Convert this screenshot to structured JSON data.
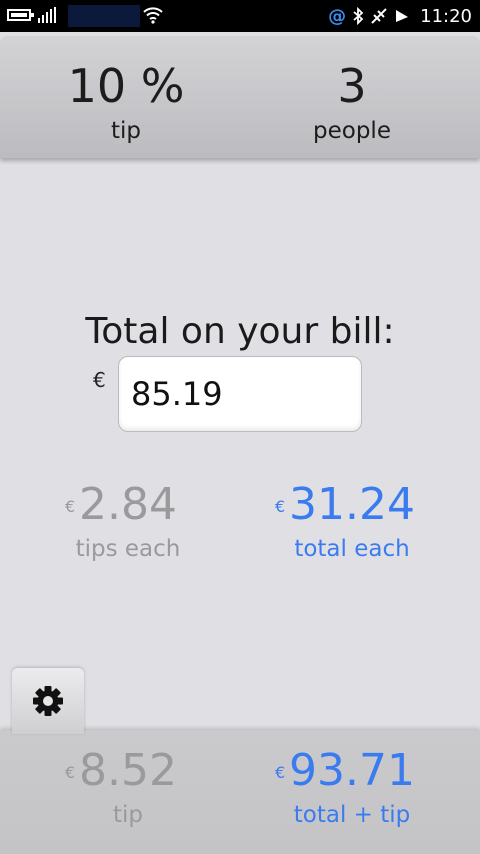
{
  "status_bar": {
    "time": "11:20",
    "icons": [
      "battery-icon",
      "signal-icon",
      "wifi-icon",
      "at-icon",
      "bluetooth-icon",
      "no-signal-icon",
      "alarm-icon"
    ]
  },
  "settings": {
    "tip": {
      "value": "10 %",
      "label": "tip"
    },
    "people": {
      "value": "3",
      "label": "people"
    }
  },
  "bill": {
    "label": "Total on your bill:",
    "currency": "€",
    "value": "85.19"
  },
  "per_person": {
    "tips_each": {
      "currency": "€",
      "value": "2.84",
      "label": "tips each"
    },
    "total_each": {
      "currency": "€",
      "value": "31.24",
      "label": "total each"
    }
  },
  "totals": {
    "tip": {
      "currency": "€",
      "value": "8.52",
      "label": "tip"
    },
    "total_tip": {
      "currency": "€",
      "value": "93.71",
      "label": "total + tip"
    }
  },
  "colors": {
    "accent_blue": "#3b7bf0",
    "muted_grey": "#9a9a9c",
    "background": "#e0e0e4"
  }
}
